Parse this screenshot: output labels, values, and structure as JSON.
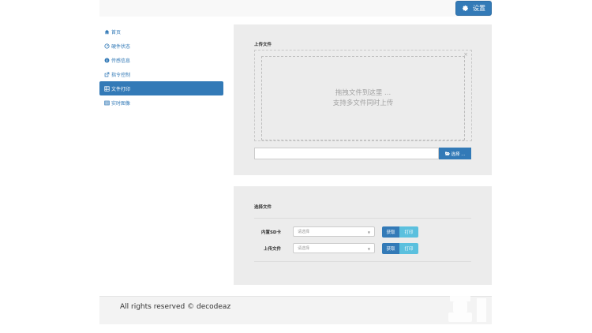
{
  "header": {
    "settings_label": "设置"
  },
  "sidebar": {
    "items": [
      {
        "label": "首页",
        "icon": "home-icon"
      },
      {
        "label": "硬件状态",
        "icon": "dashboard-icon"
      },
      {
        "label": "传感信息",
        "icon": "info-icon"
      },
      {
        "label": "指令控制",
        "icon": "external-link-icon"
      },
      {
        "label": "文件打印",
        "icon": "list-icon",
        "active": true
      },
      {
        "label": "实时图像",
        "icon": "film-icon"
      }
    ]
  },
  "upload": {
    "title": "上传文件",
    "drop_line1": "拖拽文件到这里 ...",
    "drop_line2": "支持多文件同时上传",
    "close_symbol": "×",
    "browse_label": "选择 ..."
  },
  "select_files": {
    "title": "选择文件",
    "rows": [
      {
        "label": "内置SD卡",
        "placeholder": "请选择",
        "get_label": "获取",
        "print_label": "打印"
      },
      {
        "label": "上传文件",
        "placeholder": "请选择",
        "get_label": "获取",
        "print_label": "打印"
      }
    ]
  },
  "footer": {
    "copyright": "All rights reserved © decodeaz"
  },
  "colors": {
    "primary": "#337ab7",
    "info": "#5bc0de",
    "panel": "#ececec"
  }
}
